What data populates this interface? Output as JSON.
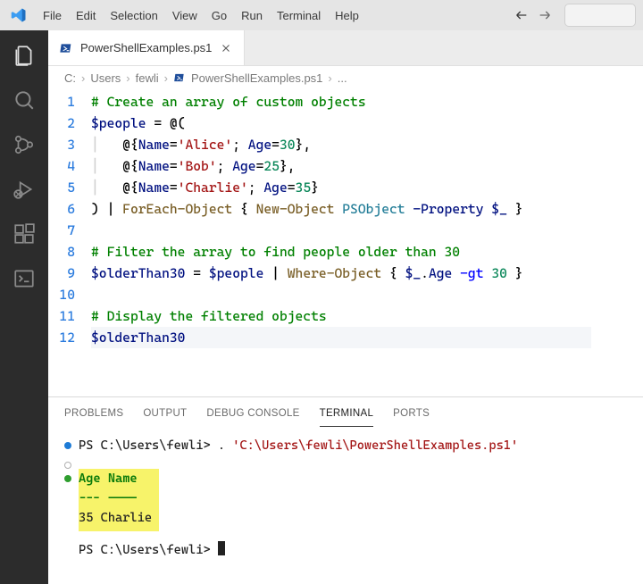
{
  "menu": {
    "items": [
      "File",
      "Edit",
      "Selection",
      "View",
      "Go",
      "Run",
      "Terminal",
      "Help"
    ]
  },
  "tabs": {
    "file_icon_label": "PS",
    "file_name": "PowerShellExamples.ps1"
  },
  "breadcrumb": {
    "parts": [
      "C:",
      "Users",
      "fewli",
      "PowerShellExamples.ps1",
      "..."
    ],
    "file_icon_label": "PS"
  },
  "editor": {
    "lines": [
      {
        "n": "1",
        "tokens": [
          [
            "c-comment",
            "# Create an array of custom objects"
          ]
        ]
      },
      {
        "n": "2",
        "tokens": [
          [
            "c-var",
            "$people"
          ],
          [
            "c-punct",
            " = "
          ],
          [
            "c-punct",
            "@("
          ]
        ]
      },
      {
        "n": "3",
        "tokens": [
          [
            "c-guide",
            "│   "
          ],
          [
            "c-punct",
            "@{"
          ],
          [
            "c-var",
            "Name"
          ],
          [
            "c-punct",
            "="
          ],
          [
            "c-str",
            "'Alice'"
          ],
          [
            "c-punct",
            "; "
          ],
          [
            "c-var",
            "Age"
          ],
          [
            "c-punct",
            "="
          ],
          [
            "c-num",
            "30"
          ],
          [
            "c-punct",
            "},"
          ]
        ]
      },
      {
        "n": "4",
        "tokens": [
          [
            "c-guide",
            "│   "
          ],
          [
            "c-punct",
            "@{"
          ],
          [
            "c-var",
            "Name"
          ],
          [
            "c-punct",
            "="
          ],
          [
            "c-str",
            "'Bob'"
          ],
          [
            "c-punct",
            "; "
          ],
          [
            "c-var",
            "Age"
          ],
          [
            "c-punct",
            "="
          ],
          [
            "c-num",
            "25"
          ],
          [
            "c-punct",
            "},"
          ]
        ]
      },
      {
        "n": "5",
        "tokens": [
          [
            "c-guide",
            "│   "
          ],
          [
            "c-punct",
            "@{"
          ],
          [
            "c-var",
            "Name"
          ],
          [
            "c-punct",
            "="
          ],
          [
            "c-str",
            "'Charlie'"
          ],
          [
            "c-punct",
            "; "
          ],
          [
            "c-var",
            "Age"
          ],
          [
            "c-punct",
            "="
          ],
          [
            "c-num",
            "35"
          ],
          [
            "c-punct",
            "}"
          ]
        ]
      },
      {
        "n": "6",
        "tokens": [
          [
            "c-punct",
            ") | "
          ],
          [
            "c-cmd",
            "ForEach-Object"
          ],
          [
            "c-punct",
            " { "
          ],
          [
            "c-cmd",
            "New-Object"
          ],
          [
            "c-punct",
            " "
          ],
          [
            "c-type",
            "PSObject"
          ],
          [
            "c-punct",
            " "
          ],
          [
            "c-param",
            "-Property"
          ],
          [
            "c-punct",
            " "
          ],
          [
            "c-var",
            "$_"
          ],
          [
            "c-punct",
            " }"
          ]
        ]
      },
      {
        "n": "7",
        "tokens": [
          [
            "",
            ""
          ]
        ]
      },
      {
        "n": "8",
        "tokens": [
          [
            "c-comment",
            "# Filter the array to find people older than 30"
          ]
        ]
      },
      {
        "n": "9",
        "tokens": [
          [
            "c-var",
            "$olderThan30"
          ],
          [
            "c-punct",
            " = "
          ],
          [
            "c-var",
            "$people"
          ],
          [
            "c-punct",
            " | "
          ],
          [
            "c-cmd",
            "Where-Object"
          ],
          [
            "c-punct",
            " { "
          ],
          [
            "c-var",
            "$_"
          ],
          [
            "c-punct",
            "."
          ],
          [
            "c-var",
            "Age"
          ],
          [
            "c-punct",
            " "
          ],
          [
            "c-key",
            "-gt"
          ],
          [
            "c-punct",
            " "
          ],
          [
            "c-num",
            "30"
          ],
          [
            "c-punct",
            " }"
          ]
        ]
      },
      {
        "n": "10",
        "tokens": [
          [
            "",
            ""
          ]
        ]
      },
      {
        "n": "11",
        "tokens": [
          [
            "c-comment",
            "# Display the filtered objects"
          ]
        ]
      },
      {
        "n": "12",
        "tokens": [
          [
            "c-var",
            "$olderThan30"
          ]
        ],
        "current": true
      }
    ]
  },
  "panel": {
    "tabs": [
      "PROBLEMS",
      "OUTPUT",
      "DEBUG CONSOLE",
      "TERMINAL",
      "PORTS"
    ],
    "active": "TERMINAL"
  },
  "terminal": {
    "line1_prompt": "PS C:\\Users\\fewli> ",
    "line1_cmd_dot": ". ",
    "line1_path": "'C:\\Users\\fewli\\PowerShellExamples.ps1'",
    "hl_header": "Age Name",
    "hl_divider": "--- ----",
    "hl_row": " 35 Charlie",
    "prompt2": "PS C:\\Users\\fewli> "
  }
}
